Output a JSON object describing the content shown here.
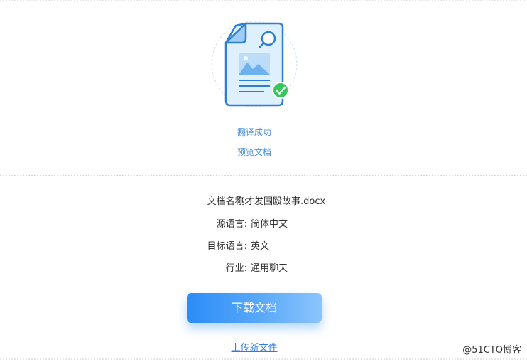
{
  "status": {
    "success_text": "翻译成功",
    "preview_link": "预览文档"
  },
  "document_info": {
    "rows": [
      {
        "label": "文档名称:",
        "value": "刚才发围殴故事.docx"
      },
      {
        "label": "源语言:",
        "value": "简体中文"
      },
      {
        "label": "目标语言:",
        "value": "英文"
      },
      {
        "label": "行业:",
        "value": "通用聊天"
      }
    ]
  },
  "actions": {
    "download_label": "下载文档",
    "upload_label": "上传新文件"
  },
  "watermark": "@51CTO博客",
  "icons": {
    "hero": "document-search-success-icon",
    "check": "check-circle-icon"
  },
  "colors": {
    "accent": "#4a90d9",
    "button_start": "#2b8cf7",
    "button_end": "#8cc4fb",
    "success": "#34c759"
  }
}
